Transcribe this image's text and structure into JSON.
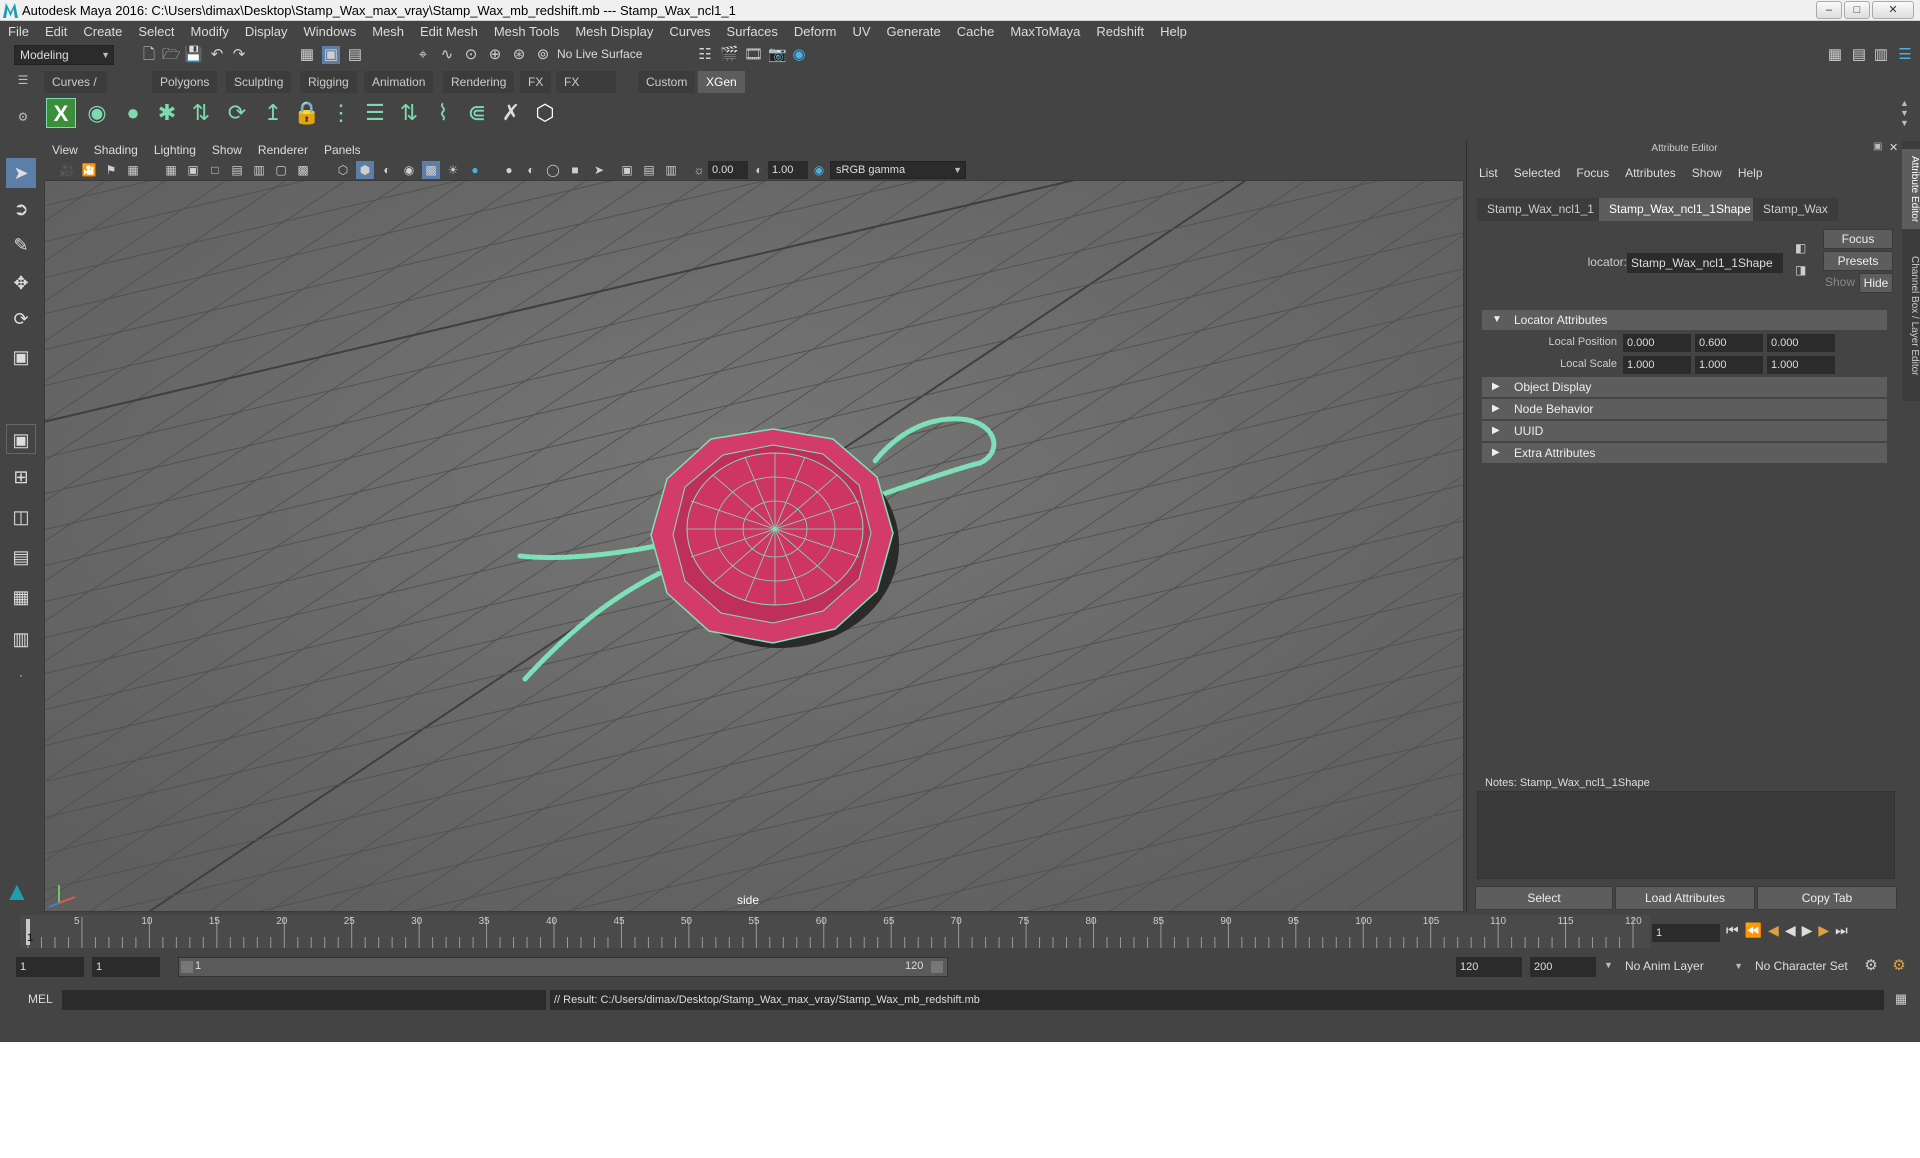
{
  "window": {
    "title": "Autodesk Maya 2016: C:\\Users\\dimax\\Desktop\\Stamp_Wax_max_vray\\Stamp_Wax_mb_redshift.mb   ---   Stamp_Wax_ncl1_1"
  },
  "menubar": [
    "File",
    "Edit",
    "Create",
    "Select",
    "Modify",
    "Display",
    "Windows",
    "Mesh",
    "Edit Mesh",
    "Mesh Tools",
    "Mesh Display",
    "Curves",
    "Surfaces",
    "Deform",
    "UV",
    "Generate",
    "Cache",
    "MaxToMaya",
    "Redshift",
    "Help"
  ],
  "statusline": {
    "mode": "Modeling",
    "live_surface": "No Live Surface"
  },
  "shelf": {
    "tabs": [
      "Curves / Surfaces",
      "Polygons",
      "Sculpting",
      "Rigging",
      "Animation",
      "Rendering",
      "FX",
      "FX Caching",
      "Custom",
      "XGen"
    ],
    "active_tab": "XGen"
  },
  "viewport": {
    "menu": [
      "View",
      "Shading",
      "Lighting",
      "Show",
      "Renderer",
      "Panels"
    ],
    "exposure": "0.00",
    "gamma": "1.00",
    "color_space": "sRGB gamma",
    "camera": "side"
  },
  "attribute_editor": {
    "title": "Attribute Editor",
    "menu": [
      "List",
      "Selected",
      "Focus",
      "Attributes",
      "Show",
      "Help"
    ],
    "tabs": [
      "Stamp_Wax_ncl1_1",
      "Stamp_Wax_ncl1_1Shape",
      "Stamp_Wax"
    ],
    "active_tab": "Stamp_Wax_ncl1_1Shape",
    "node_type_label": "locator:",
    "node_name": "Stamp_Wax_ncl1_1Shape",
    "focus_label": "Focus",
    "presets_label": "Presets",
    "show_label": "Show",
    "hide_label": "Hide",
    "sections": {
      "locator": "Locator Attributes",
      "object_display": "Object Display",
      "node_behavior": "Node Behavior",
      "uuid": "UUID",
      "extra": "Extra Attributes"
    },
    "local_position": {
      "label": "Local Position",
      "x": "0.000",
      "y": "0.600",
      "z": "0.000"
    },
    "local_scale": {
      "label": "Local Scale",
      "x": "1.000",
      "y": "1.000",
      "z": "1.000"
    },
    "notes_label": "Notes:  Stamp_Wax_ncl1_1Shape",
    "buttons": {
      "select": "Select",
      "load": "Load Attributes",
      "copy": "Copy Tab"
    }
  },
  "side_tabs": [
    "Attribute Editor",
    "Channel Box / Layer Editor"
  ],
  "timeline": {
    "ticks": [
      "5",
      "10",
      "15",
      "20",
      "25",
      "30",
      "35",
      "40",
      "45",
      "50",
      "55",
      "60",
      "65",
      "70",
      "75",
      "80",
      "85",
      "90",
      "95",
      "100",
      "105",
      "110",
      "115",
      "120"
    ],
    "start_tick": "1",
    "current_frame": "1"
  },
  "range": {
    "start": "1",
    "playback_start": "1",
    "slider_start": "1",
    "slider_end": "120",
    "playback_end": "120",
    "end": "200",
    "anim_layer": "No Anim Layer",
    "character_set": "No Character Set"
  },
  "cmdline": {
    "lang": "MEL",
    "result": "// Result: C:/Users/dimax/Desktop/Stamp_Wax_max_vray/Stamp_Wax_mb_redshift.mb"
  },
  "colors": {
    "ui_bg": "#444444",
    "viewport_bg": "#6e6e6e",
    "wax": "#d33c6a",
    "wire": "#7ee0b8"
  }
}
